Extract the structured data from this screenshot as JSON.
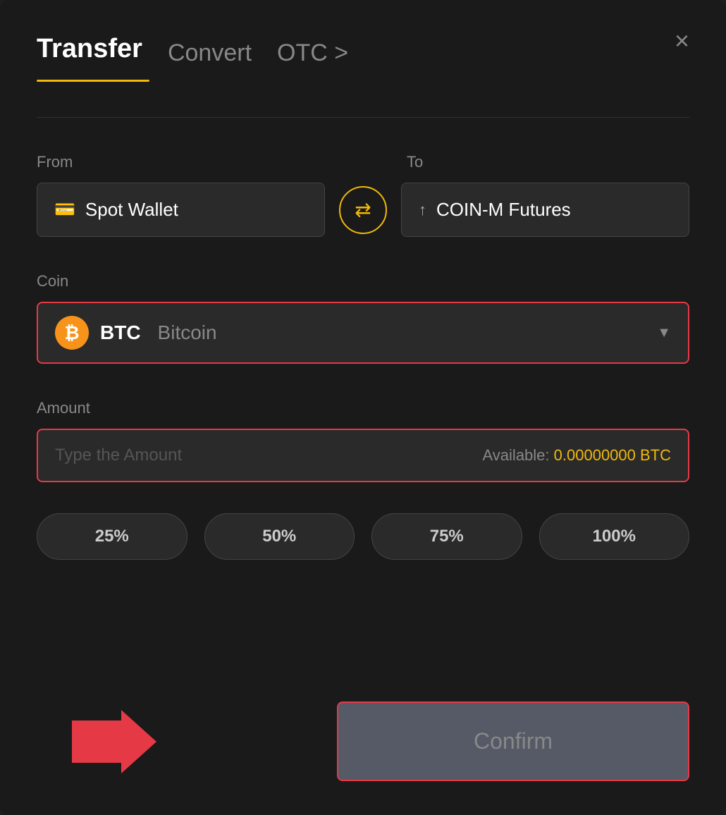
{
  "header": {
    "active_tab": "Transfer",
    "tabs": [
      {
        "id": "transfer",
        "label": "Transfer",
        "active": true
      },
      {
        "id": "convert",
        "label": "Convert",
        "active": false
      },
      {
        "id": "otc",
        "label": "OTC >",
        "active": false
      }
    ],
    "close_label": "×"
  },
  "from_section": {
    "label": "From",
    "wallet_icon": "💳",
    "wallet_name": "Spot Wallet"
  },
  "to_section": {
    "label": "To",
    "wallet_icon": "↑",
    "wallet_name": "COIN-M Futures"
  },
  "swap": {
    "icon": "⇄"
  },
  "coin_section": {
    "label": "Coin",
    "coin_symbol": "BTC",
    "coin_name": "Bitcoin",
    "coin_icon": "₿"
  },
  "amount_section": {
    "label": "Amount",
    "placeholder": "Type the Amount",
    "available_label": "Available:",
    "available_value": "0.00000000 BTC"
  },
  "percentage_buttons": [
    {
      "label": "25%",
      "value": "25"
    },
    {
      "label": "50%",
      "value": "50"
    },
    {
      "label": "75%",
      "value": "75"
    },
    {
      "label": "100%",
      "value": "100"
    }
  ],
  "confirm_button": {
    "label": "Confirm"
  }
}
